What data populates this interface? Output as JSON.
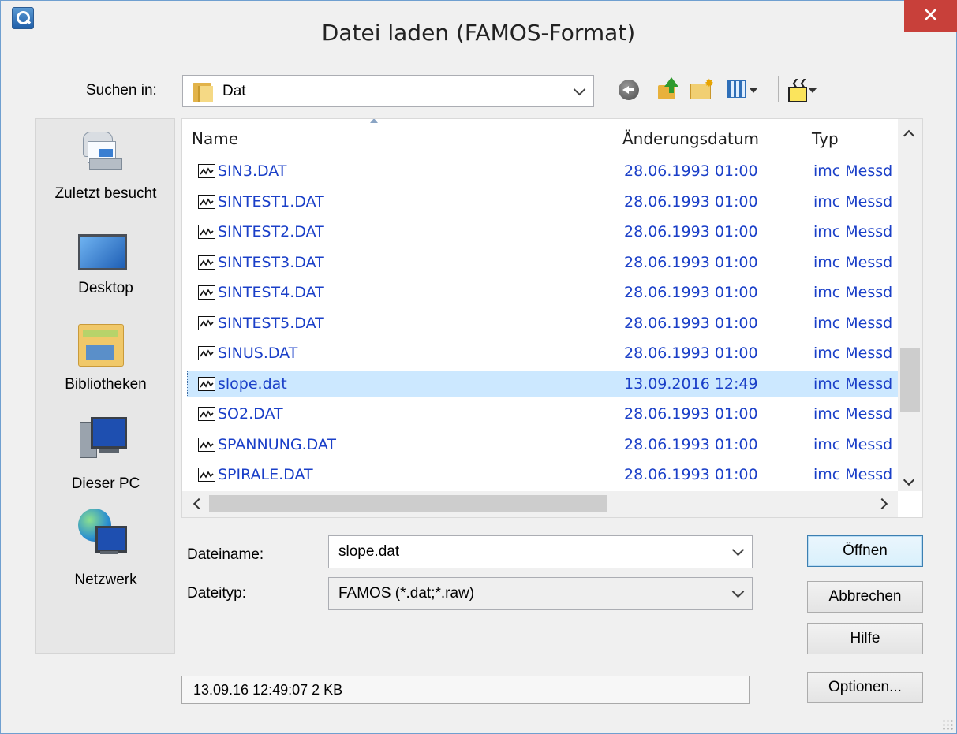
{
  "window": {
    "title": "Datei laden  (FAMOS-Format)",
    "close_glyph": "✕"
  },
  "lookin": {
    "label": "Suchen in:",
    "value": "Dat"
  },
  "toolbar": {
    "back": "back-icon",
    "up": "up-folder-icon",
    "new_folder": "new-folder-icon",
    "view": "view-menu-icon",
    "tools": "tools-icon"
  },
  "places": [
    {
      "label": "Zuletzt besucht",
      "icon": "recent-places-icon"
    },
    {
      "label": "Desktop",
      "icon": "desktop-icon"
    },
    {
      "label": "Bibliotheken",
      "icon": "libraries-icon"
    },
    {
      "label": "Dieser PC",
      "icon": "computer-icon"
    },
    {
      "label": "Netzwerk",
      "icon": "network-icon"
    }
  ],
  "columns": {
    "name": "Name",
    "date": "Änderungsdatum",
    "type": "Typ"
  },
  "files": [
    {
      "name": "SIN3.DAT",
      "date": "28.06.1993 01:00",
      "type": "imc Messd"
    },
    {
      "name": "SINTEST1.DAT",
      "date": "28.06.1993 01:00",
      "type": "imc Messd"
    },
    {
      "name": "SINTEST2.DAT",
      "date": "28.06.1993 01:00",
      "type": "imc Messd"
    },
    {
      "name": "SINTEST3.DAT",
      "date": "28.06.1993 01:00",
      "type": "imc Messd"
    },
    {
      "name": "SINTEST4.DAT",
      "date": "28.06.1993 01:00",
      "type": "imc Messd"
    },
    {
      "name": "SINTEST5.DAT",
      "date": "28.06.1993 01:00",
      "type": "imc Messd"
    },
    {
      "name": "SINUS.DAT",
      "date": "28.06.1993 01:00",
      "type": "imc Messd"
    },
    {
      "name": "slope.dat",
      "date": "13.09.2016 12:49",
      "type": "imc Messd",
      "selected": true
    },
    {
      "name": "SO2.DAT",
      "date": "28.06.1993 01:00",
      "type": "imc Messd"
    },
    {
      "name": "SPANNUNG.DAT",
      "date": "28.06.1993 01:00",
      "type": "imc Messd"
    },
    {
      "name": "SPIRALE.DAT",
      "date": "28.06.1993 01:00",
      "type": "imc Messd"
    }
  ],
  "filename": {
    "label": "Dateiname:",
    "value": "slope.dat"
  },
  "filetype": {
    "label": "Dateityp:",
    "value": "FAMOS (*.dat;*.raw)"
  },
  "buttons": {
    "open": "Öffnen",
    "cancel": "Abbrechen",
    "help": "Hilfe",
    "options": "Optionen..."
  },
  "status": "13.09.16 12:49:07  2 KB",
  "colors": {
    "link": "#1a3fc8",
    "selection": "#cce8ff",
    "close": "#c8403a"
  }
}
